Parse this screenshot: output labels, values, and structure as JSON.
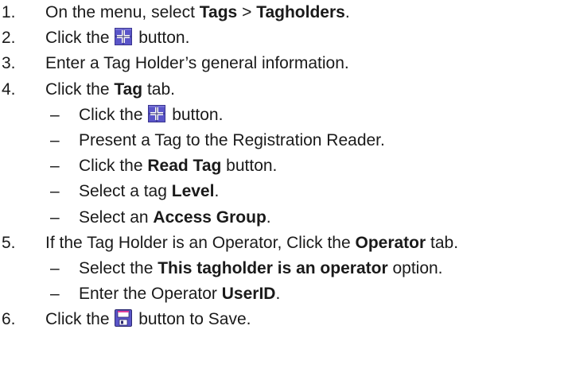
{
  "steps": [
    {
      "number": "1.",
      "parts": [
        {
          "t": "text",
          "v": "On the menu, select "
        },
        {
          "t": "bold",
          "v": "Tags"
        },
        {
          "t": "text",
          "v": " > "
        },
        {
          "t": "bold",
          "v": "Tagholders"
        },
        {
          "t": "text",
          "v": "."
        }
      ],
      "substeps": []
    },
    {
      "number": "2.",
      "parts": [
        {
          "t": "text",
          "v": "Click the "
        },
        {
          "t": "icon",
          "v": "add-icon"
        },
        {
          "t": "text",
          "v": " button."
        }
      ],
      "substeps": []
    },
    {
      "number": "3.",
      "parts": [
        {
          "t": "text",
          "v": "Enter a Tag Holder’s general information."
        }
      ],
      "substeps": []
    },
    {
      "number": "4.",
      "parts": [
        {
          "t": "text",
          "v": "Click the "
        },
        {
          "t": "bold",
          "v": "Tag"
        },
        {
          "t": "text",
          "v": " tab."
        }
      ],
      "substeps": [
        {
          "bullet": "–",
          "parts": [
            {
              "t": "text",
              "v": "Click the "
            },
            {
              "t": "icon",
              "v": "add-icon"
            },
            {
              "t": "text",
              "v": " button."
            }
          ]
        },
        {
          "bullet": "–",
          "parts": [
            {
              "t": "text",
              "v": "Present a Tag to the Registration Reader."
            }
          ]
        },
        {
          "bullet": "–",
          "parts": [
            {
              "t": "text",
              "v": "Click the "
            },
            {
              "t": "bold",
              "v": "Read Tag"
            },
            {
              "t": "text",
              "v": " button."
            }
          ]
        },
        {
          "bullet": "–",
          "parts": [
            {
              "t": "text",
              "v": "Select a tag "
            },
            {
              "t": "bold",
              "v": "Level"
            },
            {
              "t": "text",
              "v": "."
            }
          ]
        },
        {
          "bullet": "–",
          "parts": [
            {
              "t": "text",
              "v": "Select an "
            },
            {
              "t": "bold",
              "v": "Access Group"
            },
            {
              "t": "text",
              "v": "."
            }
          ]
        }
      ]
    },
    {
      "number": "5.",
      "parts": [
        {
          "t": "text",
          "v": "If the Tag Holder is an Operator, Click the "
        },
        {
          "t": "bold",
          "v": "Operator"
        },
        {
          "t": "text",
          "v": " tab."
        }
      ],
      "substeps": [
        {
          "bullet": "–",
          "parts": [
            {
              "t": "text",
              "v": "Select the "
            },
            {
              "t": "bold",
              "v": "This tagholder is an operator"
            },
            {
              "t": "text",
              "v": " option."
            }
          ]
        },
        {
          "bullet": "–",
          "parts": [
            {
              "t": "text",
              "v": "Enter the Operator "
            },
            {
              "t": "bold",
              "v": "UserID"
            },
            {
              "t": "text",
              "v": "."
            }
          ]
        }
      ]
    },
    {
      "number": "6.",
      "parts": [
        {
          "t": "text",
          "v": "Click the "
        },
        {
          "t": "icon",
          "v": "save-icon"
        },
        {
          "t": "text",
          "v": " button to Save."
        }
      ],
      "substeps": []
    }
  ],
  "colors": {
    "text": "#1a1a1a",
    "add_icon_fill": "#5a55c8",
    "add_icon_dark": "#3a3590",
    "save_icon_fill": "#5a55c8",
    "save_icon_accent": "#e0409a"
  }
}
